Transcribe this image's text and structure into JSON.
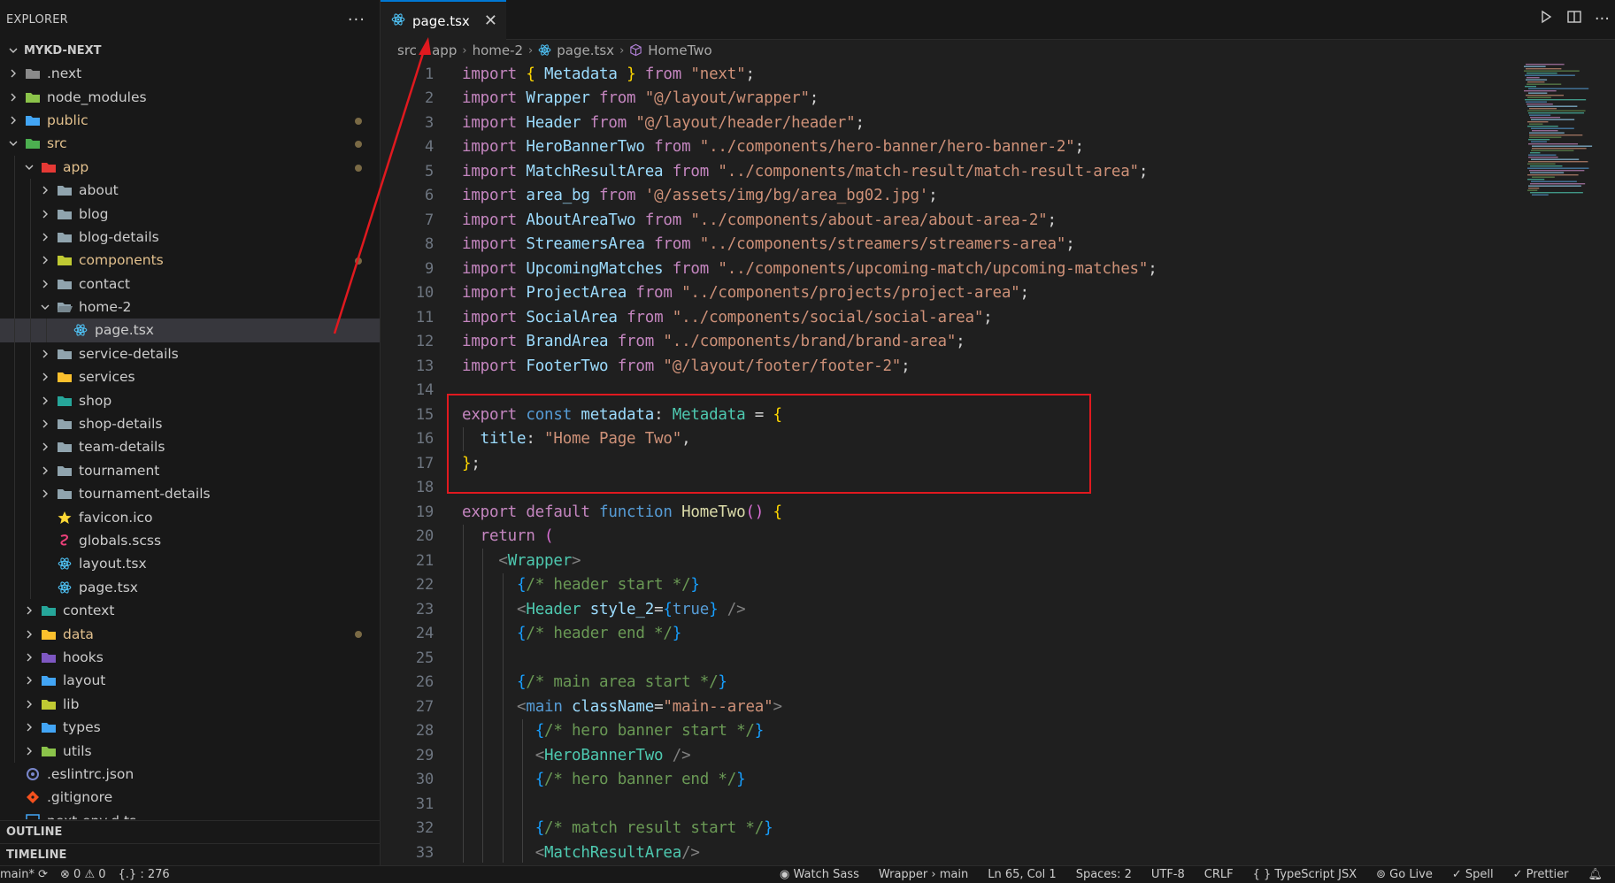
{
  "sidebar": {
    "title": "EXPLORER",
    "more_actions": "···",
    "project": "MYKD-NEXT",
    "tree": [
      {
        "label": ".next",
        "depth": 0,
        "chevron": "right",
        "icon": "folder-next-icon",
        "icon_color": "#8a8a8a"
      },
      {
        "label": "node_modules",
        "depth": 0,
        "chevron": "right",
        "icon": "folder-node-icon",
        "icon_color": "#8bc34a"
      },
      {
        "label": "public",
        "depth": 0,
        "chevron": "right",
        "icon": "folder-public-icon",
        "icon_color": "#42a5f5",
        "label_color": "#e2c08d",
        "dot": true
      },
      {
        "label": "src",
        "depth": 0,
        "chevron": "down",
        "icon": "folder-src-icon",
        "icon_color": "#4caf50",
        "label_color": "#e2c08d",
        "dot": true
      },
      {
        "label": "app",
        "depth": 1,
        "chevron": "down",
        "icon": "folder-app-icon",
        "icon_color": "#e53935",
        "label_color": "#e2c08d",
        "dot": true
      },
      {
        "label": "about",
        "depth": 2,
        "chevron": "right",
        "icon": "folder-icon",
        "icon_color": "#90a4ae"
      },
      {
        "label": "blog",
        "depth": 2,
        "chevron": "right",
        "icon": "folder-icon",
        "icon_color": "#90a4ae"
      },
      {
        "label": "blog-details",
        "depth": 2,
        "chevron": "right",
        "icon": "folder-icon",
        "icon_color": "#90a4ae"
      },
      {
        "label": "components",
        "depth": 2,
        "chevron": "right",
        "icon": "folder-components-icon",
        "icon_color": "#c0ca33",
        "label_color": "#e2c08d",
        "dot": true
      },
      {
        "label": "contact",
        "depth": 2,
        "chevron": "right",
        "icon": "folder-icon",
        "icon_color": "#90a4ae"
      },
      {
        "label": "home-2",
        "depth": 2,
        "chevron": "down",
        "icon": "folder-open-icon",
        "icon_color": "#90a4ae"
      },
      {
        "label": "page.tsx",
        "depth": 3,
        "chevron": "",
        "icon": "react-icon",
        "icon_color": "#4fc3f7",
        "selected": true
      },
      {
        "label": "service-details",
        "depth": 2,
        "chevron": "right",
        "icon": "folder-icon",
        "icon_color": "#90a4ae"
      },
      {
        "label": "services",
        "depth": 2,
        "chevron": "right",
        "icon": "folder-services-icon",
        "icon_color": "#fbc02d"
      },
      {
        "label": "shop",
        "depth": 2,
        "chevron": "right",
        "icon": "folder-shop-icon",
        "icon_color": "#26a69a"
      },
      {
        "label": "shop-details",
        "depth": 2,
        "chevron": "right",
        "icon": "folder-icon",
        "icon_color": "#90a4ae"
      },
      {
        "label": "team-details",
        "depth": 2,
        "chevron": "right",
        "icon": "folder-icon",
        "icon_color": "#90a4ae"
      },
      {
        "label": "tournament",
        "depth": 2,
        "chevron": "right",
        "icon": "folder-icon",
        "icon_color": "#90a4ae"
      },
      {
        "label": "tournament-details",
        "depth": 2,
        "chevron": "right",
        "icon": "folder-icon",
        "icon_color": "#90a4ae"
      },
      {
        "label": "favicon.ico",
        "depth": 2,
        "chevron": "",
        "icon": "star-icon",
        "icon_color": "#fdd835"
      },
      {
        "label": "globals.scss",
        "depth": 2,
        "chevron": "",
        "icon": "sass-icon",
        "icon_color": "#ec407a"
      },
      {
        "label": "layout.tsx",
        "depth": 2,
        "chevron": "",
        "icon": "react-icon",
        "icon_color": "#4fc3f7"
      },
      {
        "label": "page.tsx",
        "depth": 2,
        "chevron": "",
        "icon": "react-icon",
        "icon_color": "#4fc3f7"
      },
      {
        "label": "context",
        "depth": 1,
        "chevron": "right",
        "icon": "folder-context-icon",
        "icon_color": "#26a69a"
      },
      {
        "label": "data",
        "depth": 1,
        "chevron": "right",
        "icon": "folder-data-icon",
        "icon_color": "#fbc02d",
        "label_color": "#e2c08d",
        "dot": true
      },
      {
        "label": "hooks",
        "depth": 1,
        "chevron": "right",
        "icon": "folder-hooks-icon",
        "icon_color": "#7e57c2"
      },
      {
        "label": "layout",
        "depth": 1,
        "chevron": "right",
        "icon": "folder-layout-icon",
        "icon_color": "#42a5f5"
      },
      {
        "label": "lib",
        "depth": 1,
        "chevron": "right",
        "icon": "folder-lib-icon",
        "icon_color": "#c0ca33"
      },
      {
        "label": "types",
        "depth": 1,
        "chevron": "right",
        "icon": "folder-types-icon",
        "icon_color": "#42a5f5"
      },
      {
        "label": "utils",
        "depth": 1,
        "chevron": "right",
        "icon": "folder-utils-icon",
        "icon_color": "#8bc34a"
      },
      {
        "label": ".eslintrc.json",
        "depth": 0,
        "chevron": "",
        "icon": "eslint-icon",
        "icon_color": "#7986cb"
      },
      {
        "label": ".gitignore",
        "depth": 0,
        "chevron": "",
        "icon": "git-icon",
        "icon_color": "#f4511e"
      },
      {
        "label": "next-env.d.ts",
        "depth": 0,
        "chevron": "",
        "icon": "ts-file-icon",
        "icon_color": "#42a5f5"
      }
    ],
    "outline": "OUTLINE",
    "timeline": "TIMELINE"
  },
  "tab": {
    "label": "page.tsx",
    "close": "✕"
  },
  "breadcrumb": [
    "src",
    "app",
    "home-2",
    "page.tsx",
    "HomeTwo"
  ],
  "code_lines": [
    [
      [
        "kw",
        "import "
      ],
      [
        "br",
        "{ "
      ],
      [
        "id",
        "Metadata "
      ],
      [
        "br",
        "} "
      ],
      [
        "kw",
        "from "
      ],
      [
        "str",
        "\"next\""
      ],
      [
        "pl",
        ";"
      ]
    ],
    [
      [
        "kw",
        "import "
      ],
      [
        "id",
        "Wrapper "
      ],
      [
        "kw",
        "from "
      ],
      [
        "str",
        "\"@/layout/wrapper\""
      ],
      [
        "pl",
        ";"
      ]
    ],
    [
      [
        "kw",
        "import "
      ],
      [
        "id",
        "Header "
      ],
      [
        "kw",
        "from "
      ],
      [
        "str",
        "\"@/layout/header/header\""
      ],
      [
        "pl",
        ";"
      ]
    ],
    [
      [
        "kw",
        "import "
      ],
      [
        "id",
        "HeroBannerTwo "
      ],
      [
        "kw",
        "from "
      ],
      [
        "str",
        "\"../components/hero-banner/hero-banner-2\""
      ],
      [
        "pl",
        ";"
      ]
    ],
    [
      [
        "kw",
        "import "
      ],
      [
        "id",
        "MatchResultArea "
      ],
      [
        "kw",
        "from "
      ],
      [
        "str",
        "\"../components/match-result/match-result-area\""
      ],
      [
        "pl",
        ";"
      ]
    ],
    [
      [
        "kw",
        "import "
      ],
      [
        "id",
        "area_bg "
      ],
      [
        "kw",
        "from "
      ],
      [
        "str",
        "'@/assets/img/bg/area_bg02.jpg'"
      ],
      [
        "pl",
        ";"
      ]
    ],
    [
      [
        "kw",
        "import "
      ],
      [
        "id",
        "AboutAreaTwo "
      ],
      [
        "kw",
        "from "
      ],
      [
        "str",
        "\"../components/about-area/about-area-2\""
      ],
      [
        "pl",
        ";"
      ]
    ],
    [
      [
        "kw",
        "import "
      ],
      [
        "id",
        "StreamersArea "
      ],
      [
        "kw",
        "from "
      ],
      [
        "str",
        "\"../components/streamers/streamers-area\""
      ],
      [
        "pl",
        ";"
      ]
    ],
    [
      [
        "kw",
        "import "
      ],
      [
        "id",
        "UpcomingMatches "
      ],
      [
        "kw",
        "from "
      ],
      [
        "str",
        "\"../components/upcoming-match/upcoming-matches\""
      ],
      [
        "pl",
        ";"
      ]
    ],
    [
      [
        "kw",
        "import "
      ],
      [
        "id",
        "ProjectArea "
      ],
      [
        "kw",
        "from "
      ],
      [
        "str",
        "\"../components/projects/project-area\""
      ],
      [
        "pl",
        ";"
      ]
    ],
    [
      [
        "kw",
        "import "
      ],
      [
        "id",
        "SocialArea "
      ],
      [
        "kw",
        "from "
      ],
      [
        "str",
        "\"../components/social/social-area\""
      ],
      [
        "pl",
        ";"
      ]
    ],
    [
      [
        "kw",
        "import "
      ],
      [
        "id",
        "BrandArea "
      ],
      [
        "kw",
        "from "
      ],
      [
        "str",
        "\"../components/brand/brand-area\""
      ],
      [
        "pl",
        ";"
      ]
    ],
    [
      [
        "kw",
        "import "
      ],
      [
        "id",
        "FooterTwo "
      ],
      [
        "kw",
        "from "
      ],
      [
        "str",
        "\"@/layout/footer/footer-2\""
      ],
      [
        "pl",
        ";"
      ]
    ],
    [],
    [
      [
        "kw",
        "export "
      ],
      [
        "kb",
        "const "
      ],
      [
        "id",
        "metadata"
      ],
      [
        "pl",
        ": "
      ],
      [
        "ty",
        "Metadata "
      ],
      [
        "pl",
        "= "
      ],
      [
        "br",
        "{"
      ]
    ],
    [
      [
        "pl",
        "  "
      ],
      [
        "id",
        "title"
      ],
      [
        "pl",
        ": "
      ],
      [
        "str",
        "\"Home Page Two\""
      ],
      [
        "pl",
        ","
      ]
    ],
    [
      [
        "br",
        "}"
      ],
      [
        "pl",
        ";"
      ]
    ],
    [],
    [
      [
        "kw",
        "export default "
      ],
      [
        "kb",
        "function "
      ],
      [
        "fn",
        "HomeTwo"
      ],
      [
        "br2",
        "() "
      ],
      [
        "br",
        "{"
      ]
    ],
    [
      [
        "pl",
        "  "
      ],
      [
        "kw",
        "return "
      ],
      [
        "br2",
        "("
      ]
    ],
    [
      [
        "pl",
        "    "
      ],
      [
        "an",
        "<"
      ],
      [
        "tg",
        "Wrapper"
      ],
      [
        "an",
        ">"
      ]
    ],
    [
      [
        "pl",
        "      "
      ],
      [
        "br3",
        "{"
      ],
      [
        "cm",
        "/* header start */"
      ],
      [
        "br3",
        "}"
      ]
    ],
    [
      [
        "pl",
        "      "
      ],
      [
        "an",
        "<"
      ],
      [
        "tg",
        "Header "
      ],
      [
        "id",
        "style_2"
      ],
      [
        "pl",
        "="
      ],
      [
        "br3",
        "{"
      ],
      [
        "kb",
        "true"
      ],
      [
        "br3",
        "}"
      ],
      [
        "an",
        " />"
      ]
    ],
    [
      [
        "pl",
        "      "
      ],
      [
        "br3",
        "{"
      ],
      [
        "cm",
        "/* header end */"
      ],
      [
        "br3",
        "}"
      ]
    ],
    [],
    [
      [
        "pl",
        "      "
      ],
      [
        "br3",
        "{"
      ],
      [
        "cm",
        "/* main area start */"
      ],
      [
        "br3",
        "}"
      ]
    ],
    [
      [
        "pl",
        "      "
      ],
      [
        "an",
        "<"
      ],
      [
        "kb",
        "main "
      ],
      [
        "id",
        "className"
      ],
      [
        "pl",
        "="
      ],
      [
        "str",
        "\"main--area\""
      ],
      [
        "an",
        ">"
      ]
    ],
    [
      [
        "pl",
        "        "
      ],
      [
        "br3",
        "{"
      ],
      [
        "cm",
        "/* hero banner start */"
      ],
      [
        "br3",
        "}"
      ]
    ],
    [
      [
        "pl",
        "        "
      ],
      [
        "an",
        "<"
      ],
      [
        "tg",
        "HeroBannerTwo "
      ],
      [
        "an",
        "/>"
      ]
    ],
    [
      [
        "pl",
        "        "
      ],
      [
        "br3",
        "{"
      ],
      [
        "cm",
        "/* hero banner end */"
      ],
      [
        "br3",
        "}"
      ]
    ],
    [],
    [
      [
        "pl",
        "        "
      ],
      [
        "br3",
        "{"
      ],
      [
        "cm",
        "/* match result start */"
      ],
      [
        "br3",
        "}"
      ]
    ],
    [
      [
        "pl",
        "        "
      ],
      [
        "an",
        "<"
      ],
      [
        "tg",
        "MatchResultArea"
      ],
      [
        "an",
        "/>"
      ]
    ]
  ],
  "status": {
    "branch": "main*",
    "problems": "⊗ 0 ⚠ 0",
    "symbols": "{.} : 276",
    "watch_sass": "Watch Sass",
    "context": "Wrapper › main",
    "position": "Ln 65, Col 1",
    "spaces": "Spaces: 2",
    "encoding": "UTF-8",
    "eol": "CRLF",
    "language": "{ } TypeScript JSX",
    "golive": "Go Live",
    "spell": "✓ Spell",
    "prettier": "✓ Prettier"
  },
  "colors": {
    "accent": "#0078d4",
    "highlight_box": "#e0191f",
    "modified": "#e2c08d"
  }
}
